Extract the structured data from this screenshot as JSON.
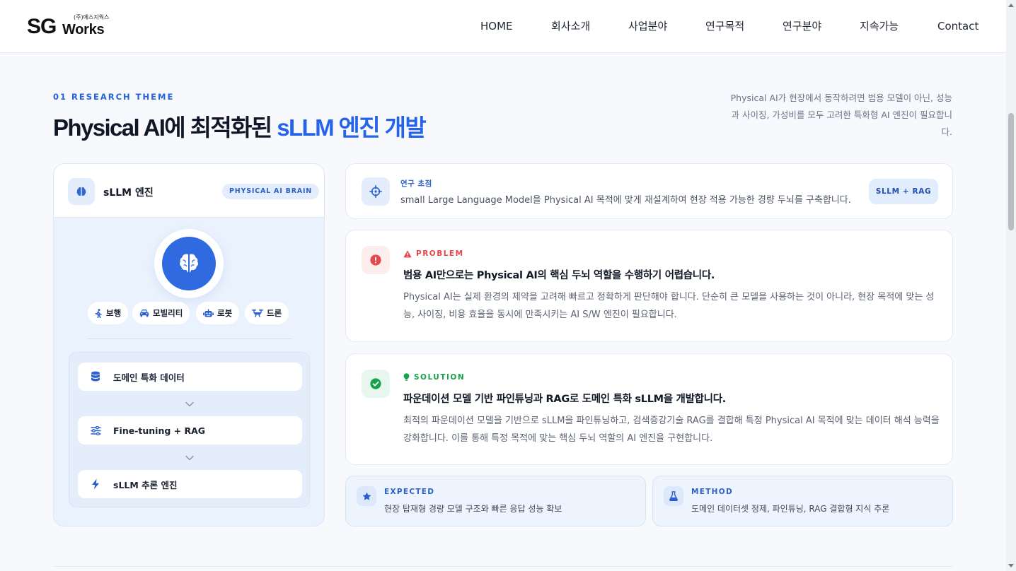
{
  "header": {
    "logo": {
      "main": "SG",
      "sub": "Works",
      "korean": "(주)에스지웍스"
    },
    "nav": [
      "HOME",
      "회사소개",
      "사업분야",
      "연구목적",
      "연구분야",
      "지속가능",
      "Contact"
    ]
  },
  "section": {
    "eyebrow": "01 RESEARCH THEME",
    "title_main": "Physical AI에 최적화된 ",
    "title_accent": "sLLM 엔진 개발",
    "intro": "Physical AI가 현장에서 동작하려면 범용 모델이 아닌, 성능과 사이징, 가성비를 모두 고려한 특화형 AI 엔진이 필요합니다."
  },
  "engine_card": {
    "title": "sLLM 엔진",
    "badge": "PHYSICAL AI BRAIN",
    "center_icon": "brain-icon",
    "chips": [
      {
        "label": "보행",
        "icon": "walking-icon"
      },
      {
        "label": "모빌리티",
        "icon": "car-icon"
      },
      {
        "label": "로봇",
        "icon": "robot-icon"
      },
      {
        "label": "드론",
        "icon": "drone-icon"
      }
    ],
    "steps": [
      {
        "label": "도메인 특화 데이터",
        "icon": "database-icon"
      },
      {
        "label": "Fine-tuning + RAG",
        "icon": "sliders-icon"
      },
      {
        "label": "sLLM 추론 엔진",
        "icon": "bolt-icon"
      }
    ]
  },
  "focus": {
    "label": "연구 초점",
    "text": "small Large Language Model을 Physical AI 목적에 맞게 재설계하여 현장 적용 가능한 경량 두뇌를 구축합니다.",
    "button": "SLLM + RAG"
  },
  "problem": {
    "label": "PROBLEM",
    "title": "범용 AI만으로는 Physical AI의 핵심 두뇌 역할을 수행하기 어렵습니다.",
    "body": "Physical AI는 실제 환경의 제약을 고려해 빠르고 정확하게 판단해야 합니다. 단순히 큰 모델을 사용하는 것이 아니라, 현장 목적에 맞는 성능, 사이징, 비용 효율을 동시에 만족시키는 AI S/W 엔진이 필요합니다.",
    "color": "#e5484d"
  },
  "solution": {
    "label": "SOLUTION",
    "title": "파운데이션 모델 기반 파인튜닝과 RAG로 도메인 특화 sLLM을 개발합니다.",
    "body": "최적의 파운데이션 모델을 기반으로 sLLM을 파인튜닝하고, 검색증강기술 RAG를 결합해 특정 Physical AI 목적에 맞는 데이터 해석 능력을 강화합니다. 이를 통해 특정 목적에 맞는 핵심 두뇌 역할의 AI 엔진을 구현합니다.",
    "color": "#16a34a"
  },
  "expected": {
    "label": "EXPECTED",
    "text": "현장 탑재형 경량 모델 구조와 빠른 응답 성능 확보"
  },
  "method": {
    "label": "METHOD",
    "text": "도메인 데이터셋 정제, 파인튜닝, RAG 결합형 지식 추론"
  },
  "colors": {
    "accent": "#2563eb",
    "background": "#f7f9fd"
  }
}
